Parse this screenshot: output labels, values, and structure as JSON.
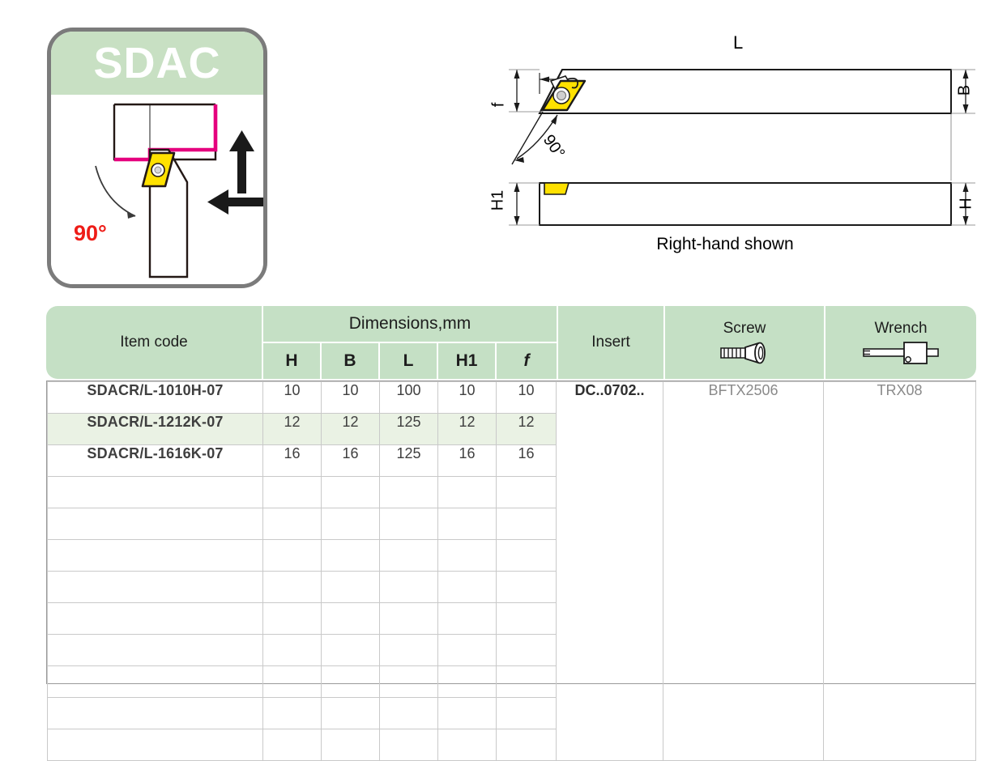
{
  "logo_card": {
    "title": "SDAC",
    "angle_label": "90°",
    "banner_color": "#c8e0c3",
    "border_color": "#7b7b7b",
    "angle_color": "#ee1c17",
    "workpiece_line_color": "#e5007e",
    "insert_color": "#ffe100"
  },
  "drawing": {
    "top_view": {
      "length_label": "L",
      "width_label": "B",
      "front_label": "f",
      "angle_label": "90°"
    },
    "side_view": {
      "height1_label": "H1",
      "height_label": "H"
    },
    "caption": "Right-hand shown",
    "insert_color": "#ffe100"
  },
  "table": {
    "header": {
      "item_code": "Item code",
      "dimensions_group": "Dimensions,mm",
      "sub_columns": [
        "H",
        "B",
        "L",
        "H1",
        "f"
      ],
      "insert": "Insert",
      "screw": "Screw",
      "wrench": "Wrench",
      "header_color": "#c5e0c5"
    },
    "rows": [
      {
        "code": "SDACR/L-1010H-07",
        "H": "10",
        "B": "10",
        "L": "100",
        "H1": "10",
        "f": "10",
        "highlight": false
      },
      {
        "code": "SDACR/L-1212K-07",
        "H": "12",
        "B": "12",
        "L": "125",
        "H1": "12",
        "f": "12",
        "highlight": true
      },
      {
        "code": "SDACR/L-1616K-07",
        "H": "16",
        "B": "16",
        "L": "125",
        "H1": "16",
        "f": "16",
        "highlight": false
      }
    ],
    "spanned": {
      "insert": "DC..0702..",
      "screw": "BFTX2506",
      "wrench": "TRX08"
    }
  }
}
